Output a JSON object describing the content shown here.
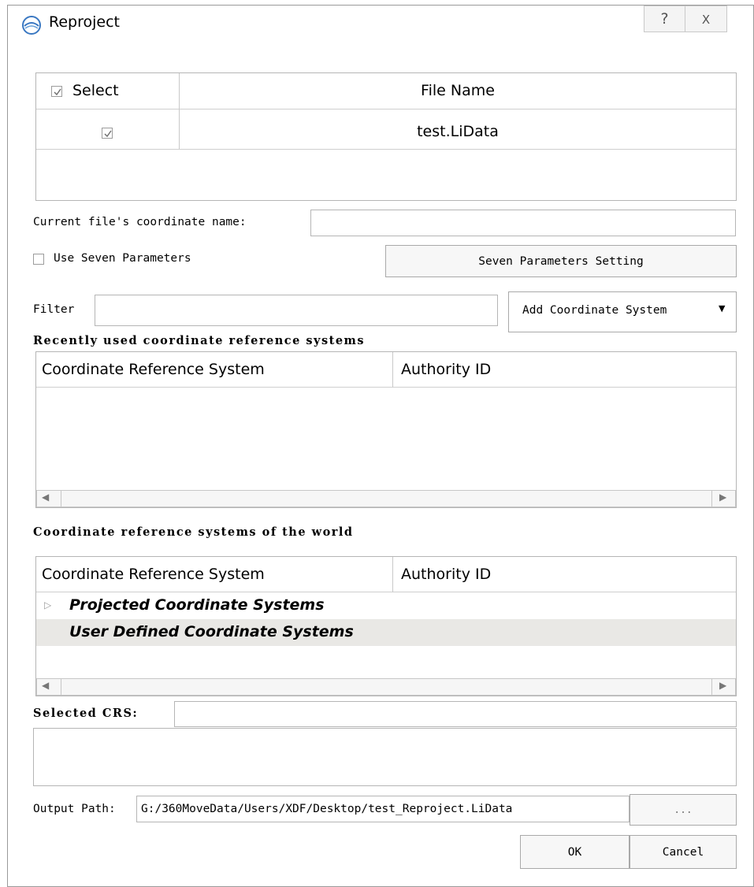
{
  "window": {
    "title": "Reproject",
    "help_glyph": "?",
    "close_glyph": "X"
  },
  "file_table": {
    "header_select": "Select",
    "header_filename": "File Name",
    "header_select_checked": true,
    "rows": [
      {
        "checked": true,
        "file_name": "test.LiData"
      }
    ]
  },
  "coord_name": {
    "label": "Current file's coordinate name:",
    "value": ""
  },
  "seven_params": {
    "checkbox_label": "Use Seven Parameters",
    "checked": false,
    "button_label": "Seven Parameters Setting"
  },
  "filter": {
    "label": "Filter",
    "value": "",
    "add_button_label": "Add Coordinate System"
  },
  "recent": {
    "heading": "Recently used coordinate reference systems",
    "col_crs": "Coordinate Reference System",
    "col_auth": "Authority ID"
  },
  "world": {
    "heading": "Coordinate reference systems of the world",
    "col_crs": "Coordinate Reference System",
    "col_auth": "Authority ID",
    "items": [
      {
        "label": "Projected Coordinate Systems"
      },
      {
        "label": "User Defined Coordinate Systems"
      }
    ]
  },
  "selected_crs": {
    "label": "Selected CRS:",
    "value": ""
  },
  "output": {
    "label": "Output Path:",
    "value": "G:/360MoveData/Users/XDF/Desktop/test_Reproject.LiData",
    "browse_label": "..."
  },
  "actions": {
    "ok_label": "OK",
    "cancel_label": "Cancel"
  },
  "colors": {
    "selected_row": "#e9e8e5",
    "border": "#b5b5b5"
  }
}
